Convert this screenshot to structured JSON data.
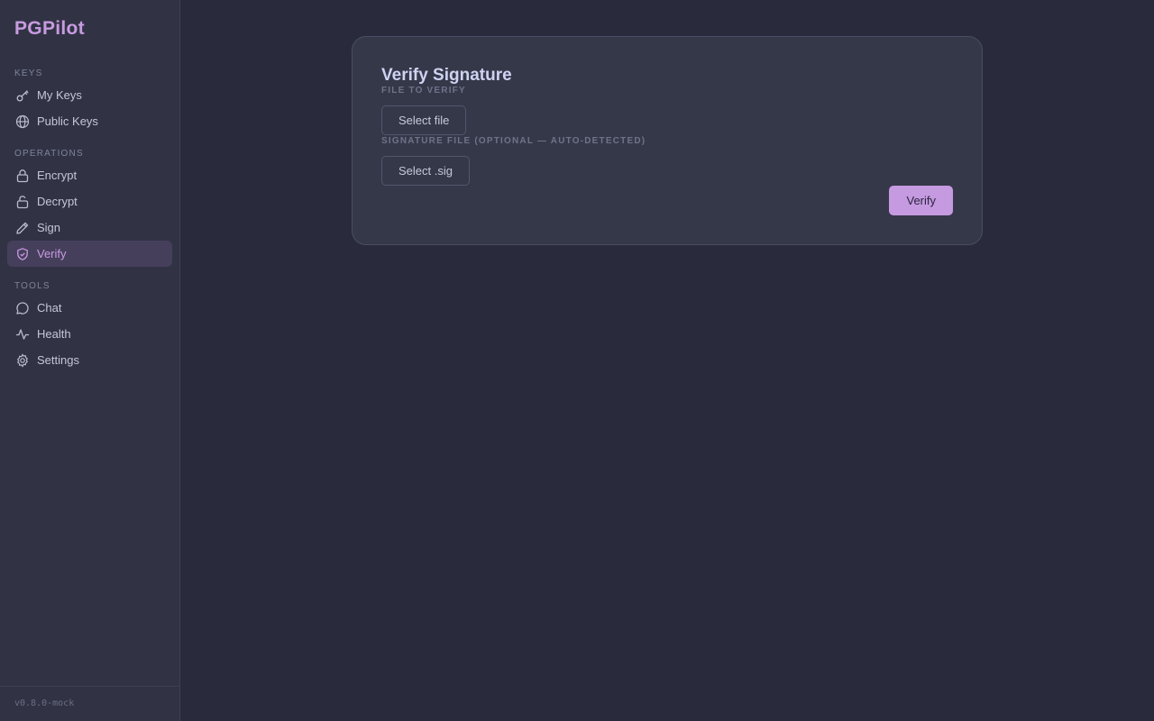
{
  "app": {
    "brand": "PGPilot",
    "version": "v0.8.0-mock"
  },
  "sidebar": {
    "sections": [
      {
        "label": "KEYS"
      },
      {
        "label": "OPERATIONS"
      },
      {
        "label": "TOOLS"
      }
    ],
    "items": [
      {
        "label": "My Keys",
        "icon": "key-icon"
      },
      {
        "label": "Public Keys",
        "icon": "globe-icon"
      },
      {
        "label": "Encrypt",
        "icon": "lock-icon"
      },
      {
        "label": "Decrypt",
        "icon": "unlock-icon"
      },
      {
        "label": "Sign",
        "icon": "pen-icon"
      },
      {
        "label": "Verify",
        "icon": "shield-check-icon",
        "active": true
      },
      {
        "label": "Chat",
        "icon": "chat-icon"
      },
      {
        "label": "Health",
        "icon": "activity-icon"
      },
      {
        "label": "Settings",
        "icon": "gear-icon"
      }
    ]
  },
  "main": {
    "title": "Verify Signature",
    "file_label": "FILE TO VERIFY",
    "file_button": "Select file",
    "sig_label": "SIGNATURE FILE (OPTIONAL — AUTO-DETECTED)",
    "sig_button": "Select .sig",
    "verify_button": "Verify"
  },
  "colors": {
    "accent": "#c69ae0",
    "background": "#292b3c",
    "sidebar": "#313345",
    "card": "#353849"
  }
}
